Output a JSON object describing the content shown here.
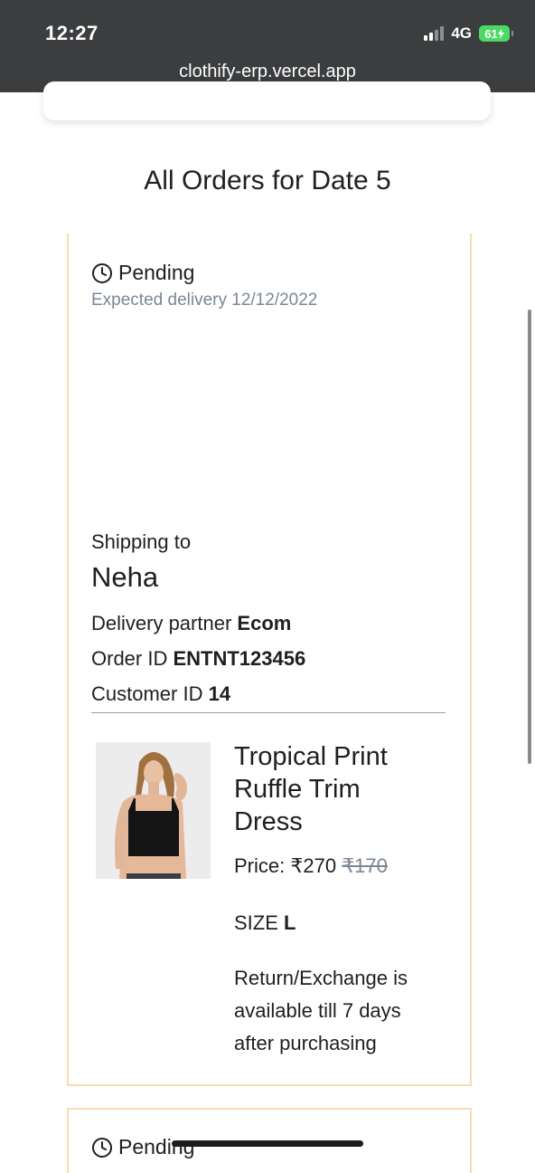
{
  "status_bar": {
    "time": "12:27",
    "network": "4G",
    "battery": "61"
  },
  "browser": {
    "url": "clothify-erp.vercel.app"
  },
  "page": {
    "title": "All Orders for Date 5"
  },
  "orders": [
    {
      "status": "Pending",
      "expected_delivery": "Expected delivery 12/12/2022",
      "shipping_label": "Shipping to",
      "customer_name": "Neha",
      "delivery_partner_label": "Delivery partner",
      "delivery_partner": "Ecom",
      "order_id_label": "Order ID",
      "order_id": "ENTNT123456",
      "customer_id_label": "Customer ID",
      "customer_id": "14",
      "product": {
        "name": "Tropical Print Ruffle Trim Dress",
        "price_label": "Price: ₹270",
        "original_price": "₹170",
        "size_label": "SIZE",
        "size": "L",
        "return_policy": "Return/Exchange is available till 7 days after purchasing"
      }
    },
    {
      "status": "Pending"
    }
  ],
  "icons": {
    "status": "clock-icon",
    "signal": "signal-bars-icon",
    "battery": "battery-charging-icon"
  },
  "colors": {
    "card_border": "#f7dcb3",
    "muted_text": "#7b8794",
    "top_bar": "#3b3d3f",
    "battery": "#4cd964"
  }
}
